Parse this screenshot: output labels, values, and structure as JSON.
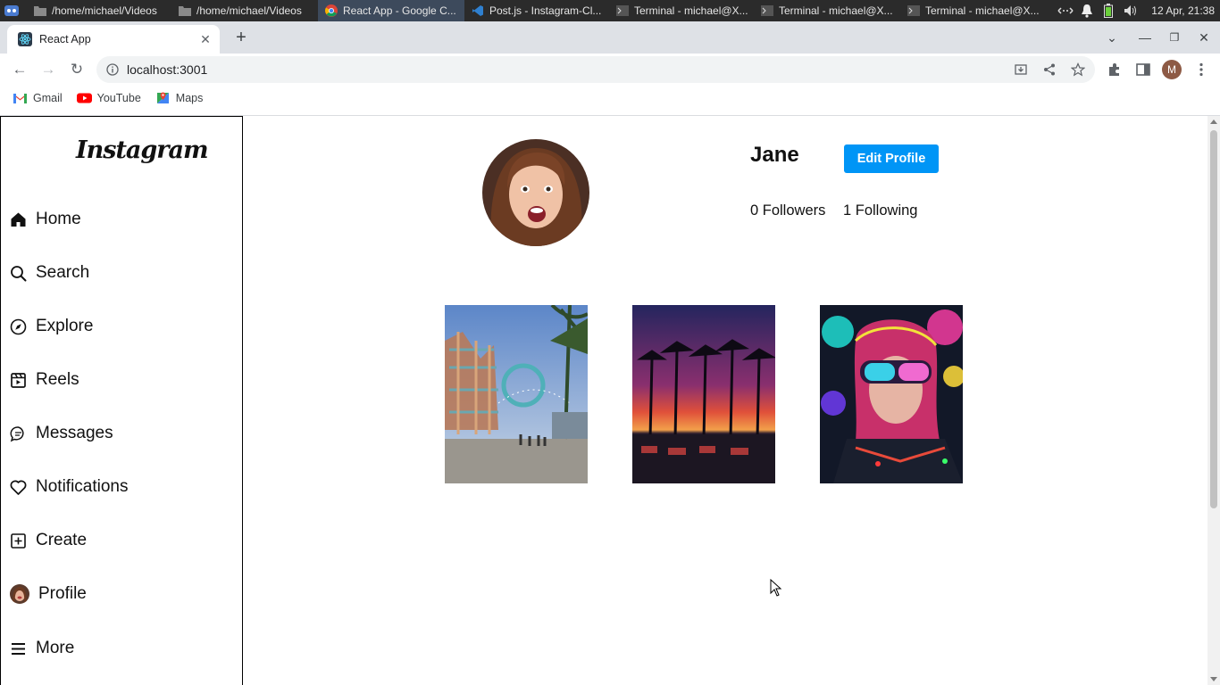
{
  "taskbar": {
    "tasks": [
      {
        "label": "/home/michael/Videos",
        "icon": "folder-icon"
      },
      {
        "label": "/home/michael/Videos",
        "icon": "folder-icon"
      },
      {
        "label": "React App - Google C...",
        "icon": "chrome-icon"
      },
      {
        "label": "Post.js - Instagram-Cl...",
        "icon": "vscode-icon"
      },
      {
        "label": "Terminal - michael@X...",
        "icon": "terminal-icon"
      },
      {
        "label": "Terminal - michael@X...",
        "icon": "terminal-icon"
      },
      {
        "label": "Terminal - michael@X...",
        "icon": "terminal-icon"
      }
    ],
    "clock": "12 Apr, 21:38"
  },
  "browser": {
    "tab_title": "React App",
    "url": "localhost:3001",
    "profile_initial": "M",
    "bookmarks": [
      {
        "label": "Gmail",
        "icon": "gmail-icon"
      },
      {
        "label": "YouTube",
        "icon": "youtube-icon"
      },
      {
        "label": "Maps",
        "icon": "maps-icon"
      }
    ]
  },
  "sidebar": {
    "logo": "Instagram",
    "items": [
      {
        "label": "Home",
        "icon": "home-icon"
      },
      {
        "label": "Search",
        "icon": "search-icon"
      },
      {
        "label": "Explore",
        "icon": "compass-icon"
      },
      {
        "label": "Reels",
        "icon": "reels-icon"
      },
      {
        "label": "Messages",
        "icon": "message-icon"
      },
      {
        "label": "Notifications",
        "icon": "heart-icon"
      },
      {
        "label": "Create",
        "icon": "plus-square-icon"
      },
      {
        "label": "Profile",
        "icon": "avatar"
      },
      {
        "label": "More",
        "icon": "menu-icon"
      }
    ]
  },
  "profile": {
    "username": "Jane",
    "edit_label": "Edit Profile",
    "followers": "0 Followers",
    "following": "1 Following"
  },
  "posts": [
    {
      "alt": "roller coaster at amusement park pier"
    },
    {
      "alt": "palm trees at sunset"
    },
    {
      "alt": "neon cyberpunk woman with goggles"
    }
  ],
  "colors": {
    "accent": "#0095f6",
    "taskbar": "#2b2b2b",
    "tabstrip": "#dee1e6"
  }
}
